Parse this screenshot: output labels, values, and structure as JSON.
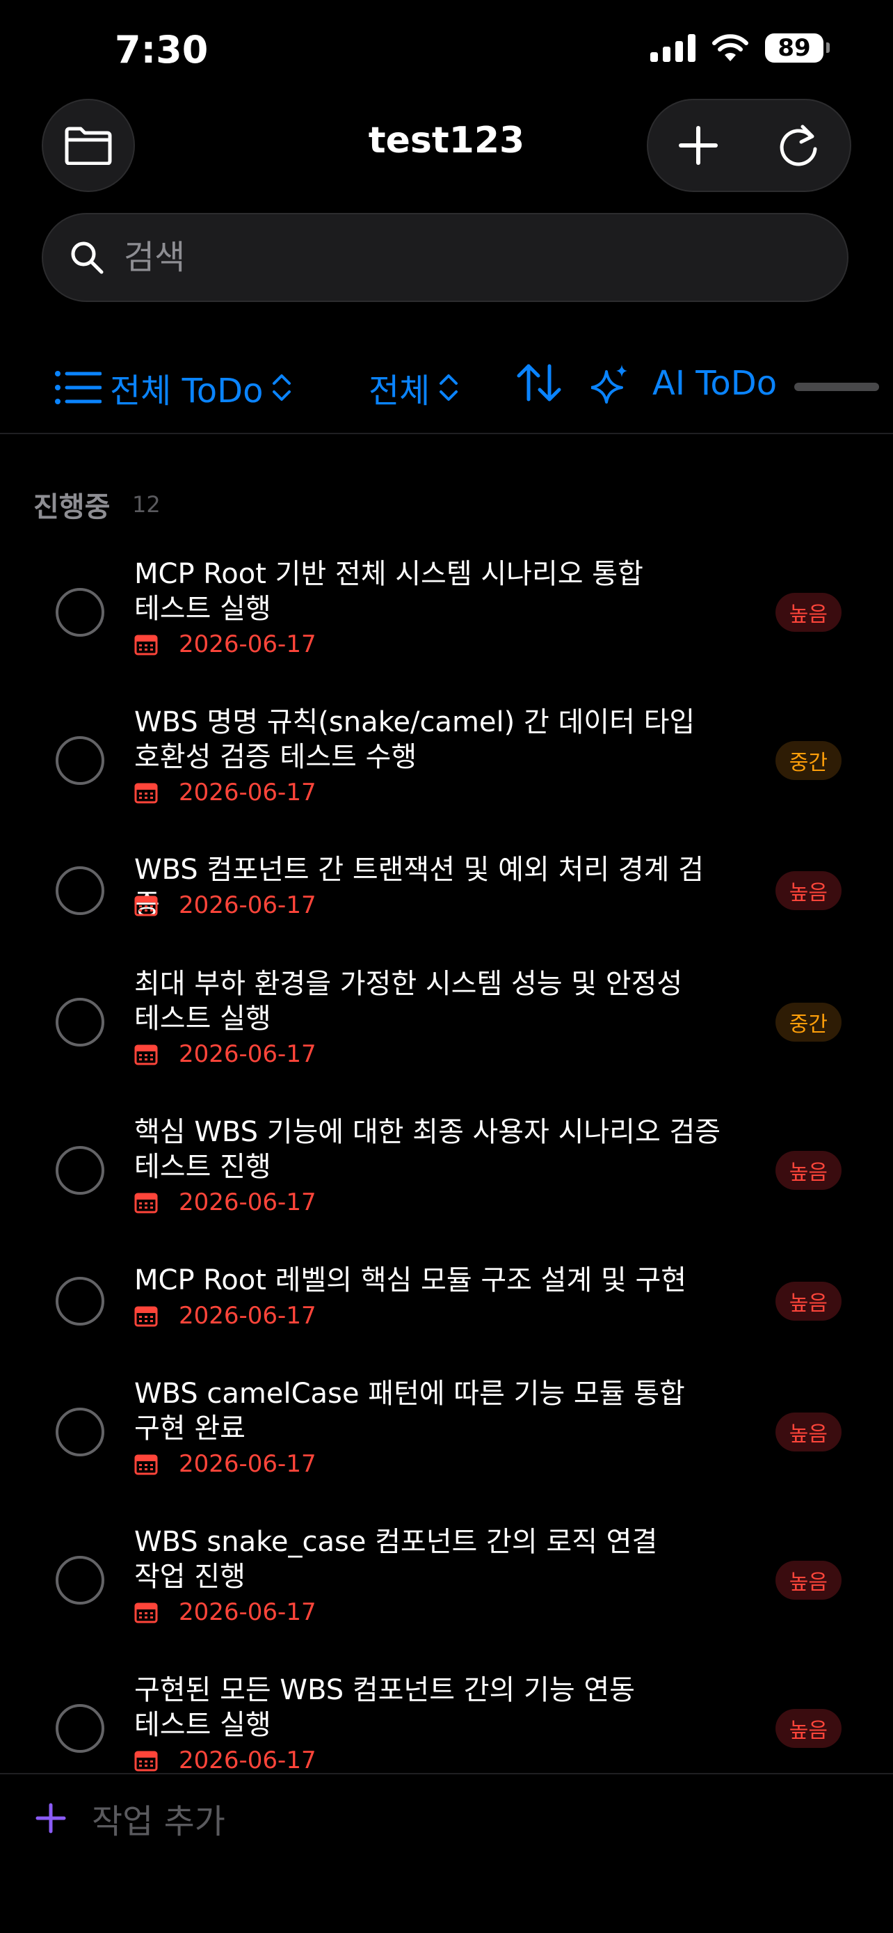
{
  "status": {
    "time": "7:30",
    "battery": "89"
  },
  "header": {
    "title": "test123"
  },
  "search": {
    "placeholder": "검색"
  },
  "filters": {
    "list": "전체 ToDo",
    "scope": "전체",
    "ai": "AI ToDo"
  },
  "section": {
    "title": "진행중",
    "count": "12"
  },
  "tasks": [
    {
      "lines": [
        "MCP Root 기반 전체 시스템 시나리오 통합",
        "테스트 실행"
      ],
      "date": "2026-06-17",
      "priority": "높음"
    },
    {
      "lines": [
        "WBS 명명 규칙(snake/camel) 간 데이터 타입",
        "호환성 검증 테스트 수행"
      ],
      "date": "2026-06-17",
      "priority": "중간"
    },
    {
      "lines": [
        "WBS 컴포넌트 간 트랜잭션 및 예외 처리 경계 검증"
      ],
      "date": "2026-06-17",
      "priority": "높음"
    },
    {
      "lines": [
        "최대 부하 환경을 가정한 시스템 성능 및 안정성",
        "테스트 실행"
      ],
      "date": "2026-06-17",
      "priority": "중간"
    },
    {
      "lines": [
        "핵심 WBS 기능에 대한 최종 사용자 시나리오 검증",
        "테스트 진행"
      ],
      "date": "2026-06-17",
      "priority": "높음"
    },
    {
      "lines": [
        "MCP Root 레벨의 핵심 모듈 구조 설계 및 구현"
      ],
      "date": "2026-06-17",
      "priority": "높음"
    },
    {
      "lines": [
        "WBS camelCase 패턴에 따른 기능 모듈 통합",
        "구현 완료"
      ],
      "date": "2026-06-17",
      "priority": "높음"
    },
    {
      "lines": [
        "WBS snake_case 컴포넌트 간의 로직 연결",
        "작업 진행"
      ],
      "date": "2026-06-17",
      "priority": "높음"
    },
    {
      "lines": [
        "구현된 모든 WBS 컴포넌트 간의 기능 연동",
        "테스트 실행"
      ],
      "date": "2026-06-17",
      "priority": "높음"
    }
  ],
  "footer": {
    "add_label": "작업 추가"
  },
  "colors": {
    "accent": "#0a84ff",
    "high": "#ff453a",
    "medium": "#ff9f0a",
    "add": "#8b5cf6"
  }
}
